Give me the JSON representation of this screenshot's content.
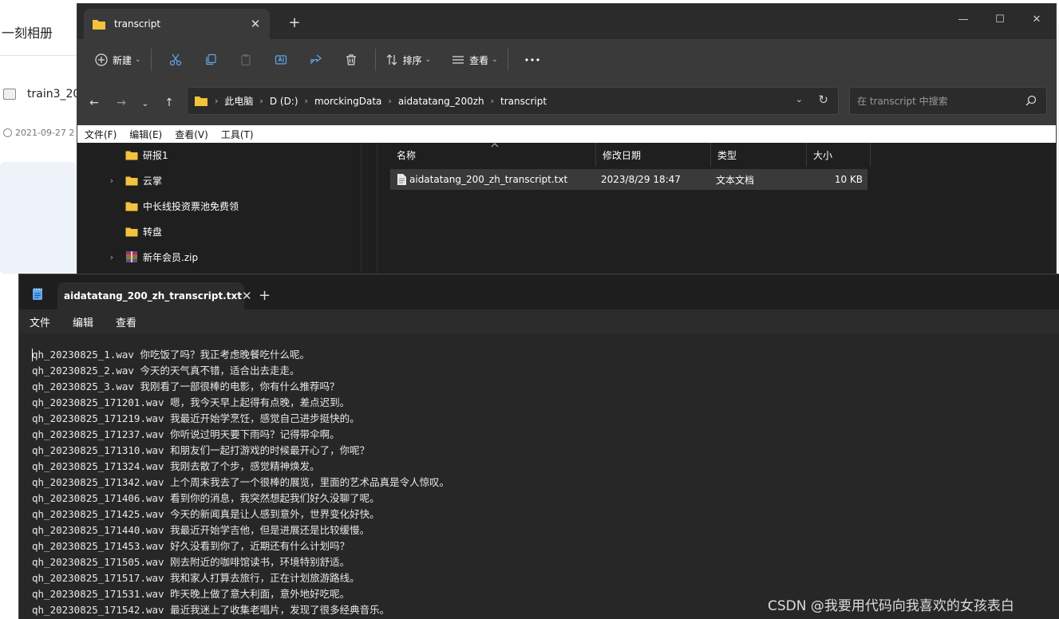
{
  "background_page": {
    "title": "一刻相册",
    "item_name": "train3_20",
    "item_date": "2021-09-27 2"
  },
  "explorer": {
    "tab_title": "transcript",
    "toolbar": {
      "new_label": "新建",
      "sort_label": "排序",
      "view_label": "查看"
    },
    "breadcrumb": [
      "此电脑",
      "D (D:)",
      "morckingData",
      "aidatatang_200zh",
      "transcript"
    ],
    "search_placeholder": "在 transcript 中搜索",
    "menu": [
      "文件(F)",
      "编辑(E)",
      "查看(V)",
      "工具(T)"
    ],
    "nav_items": [
      "研报1",
      "云掌",
      "中长线投资票池免费领",
      "转盘",
      "新年会员.zip"
    ],
    "columns": [
      "名称",
      "修改日期",
      "类型",
      "大小"
    ],
    "file": {
      "name": "aidatatang_200_zh_transcript.txt",
      "modified": "2023/8/29 18:47",
      "type": "文本文档",
      "size": "10 KB"
    },
    "colors": {
      "folder": "#f3c33d",
      "bg": "#202020",
      "toolbar": "#3a3a3a"
    }
  },
  "notepad": {
    "tab_title": "aidatatang_200_zh_transcript.txt",
    "menu": [
      "文件",
      "编辑",
      "查看"
    ],
    "lines": [
      "qh_20230825_1.wav 你吃饭了吗？我正考虑晚餐吃什么呢。",
      "qh_20230825_2.wav 今天的天气真不错，适合出去走走。",
      "qh_20230825_3.wav 我刚看了一部很棒的电影，你有什么推荐吗？",
      "qh_20230825_171201.wav 嗯，我今天早上起得有点晚，差点迟到。",
      "qh_20230825_171219.wav 我最近开始学烹饪，感觉自己进步挺快的。",
      "qh_20230825_171237.wav 你听说过明天要下雨吗？记得带伞啊。",
      "qh_20230825_171310.wav 和朋友们一起打游戏的时候最开心了，你呢？",
      "qh_20230825_171324.wav 我刚去散了个步，感觉精神焕发。",
      "qh_20230825_171342.wav 上个周末我去了一个很棒的展览，里面的艺术品真是令人惊叹。",
      "qh_20230825_171406.wav 看到你的消息，我突然想起我们好久没聊了呢。",
      "qh_20230825_171425.wav 今天的新闻真是让人感到意外，世界变化好快。",
      "qh_20230825_171440.wav 我最近开始学吉他，但是进展还是比较缓慢。",
      "qh_20230825_171453.wav 好久没看到你了，近期还有什么计划吗？",
      "qh_20230825_171505.wav 刚去附近的咖啡馆读书，环境特别舒适。",
      "qh_20230825_171517.wav 我和家人打算去旅行，正在计划旅游路线。",
      "qh_20230825_171531.wav 昨天晚上做了意大利面，意外地好吃呢。",
      "qh_20230825_171542.wav 最近我迷上了收集老唱片，发现了很多经典音乐。"
    ]
  },
  "watermark": "CSDN @我要用代码向我喜欢的女孩表白"
}
